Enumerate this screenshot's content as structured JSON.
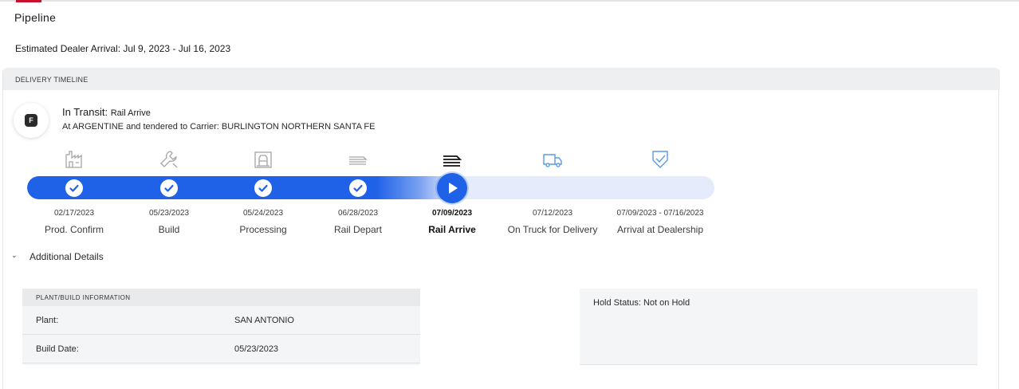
{
  "page": {
    "title": "Pipeline",
    "eta_label": "Estimated Dealer Arrival: Jul 9, 2023 - Jul 16, 2023"
  },
  "timeline": {
    "header": "DELIVERY TIMELINE",
    "badge_letter": "F",
    "status_prefix": "In Transit:",
    "status_stage": "Rail Arrive",
    "status_detail": "At ARGENTINE and tendered to Carrier: BURLINGTON NORTHERN SANTA FE",
    "progress_fraction": 0.62,
    "steps": [
      {
        "date": "02/17/2023",
        "label": "Prod. Confirm",
        "state": "done",
        "icon": "factory-icon"
      },
      {
        "date": "05/23/2023",
        "label": "Build",
        "state": "done",
        "icon": "wrench-icon"
      },
      {
        "date": "05/24/2023",
        "label": "Processing",
        "state": "done",
        "icon": "processing-icon"
      },
      {
        "date": "06/28/2023",
        "label": "Rail Depart",
        "state": "done",
        "icon": "rail-depart-icon"
      },
      {
        "date": "07/09/2023",
        "label": "Rail Arrive",
        "state": "current",
        "icon": "rail-arrive-icon"
      },
      {
        "date": "07/12/2023",
        "label": "On Truck for Delivery",
        "state": "upcoming",
        "icon": "truck-icon"
      },
      {
        "date": "07/09/2023 - 07/16/2023",
        "label": "Arrival at Dealership",
        "state": "upcoming",
        "icon": "shield-check-icon"
      }
    ]
  },
  "details": {
    "toggle_label": "Additional Details",
    "plant": {
      "header": "PLANT/BUILD INFORMATION",
      "rows": [
        {
          "label": "Plant:",
          "value": "SAN ANTONIO"
        },
        {
          "label": "Build Date:",
          "value": "05/23/2023"
        }
      ]
    },
    "hold_status": "Hold Status: Not on Hold"
  },
  "colors": {
    "accent": "#1f62e8",
    "track": "#e4ebfb",
    "brand_red": "#c8102e",
    "upcoming_icon": "#5b9be6",
    "done_icon": "#a4a4a4"
  }
}
